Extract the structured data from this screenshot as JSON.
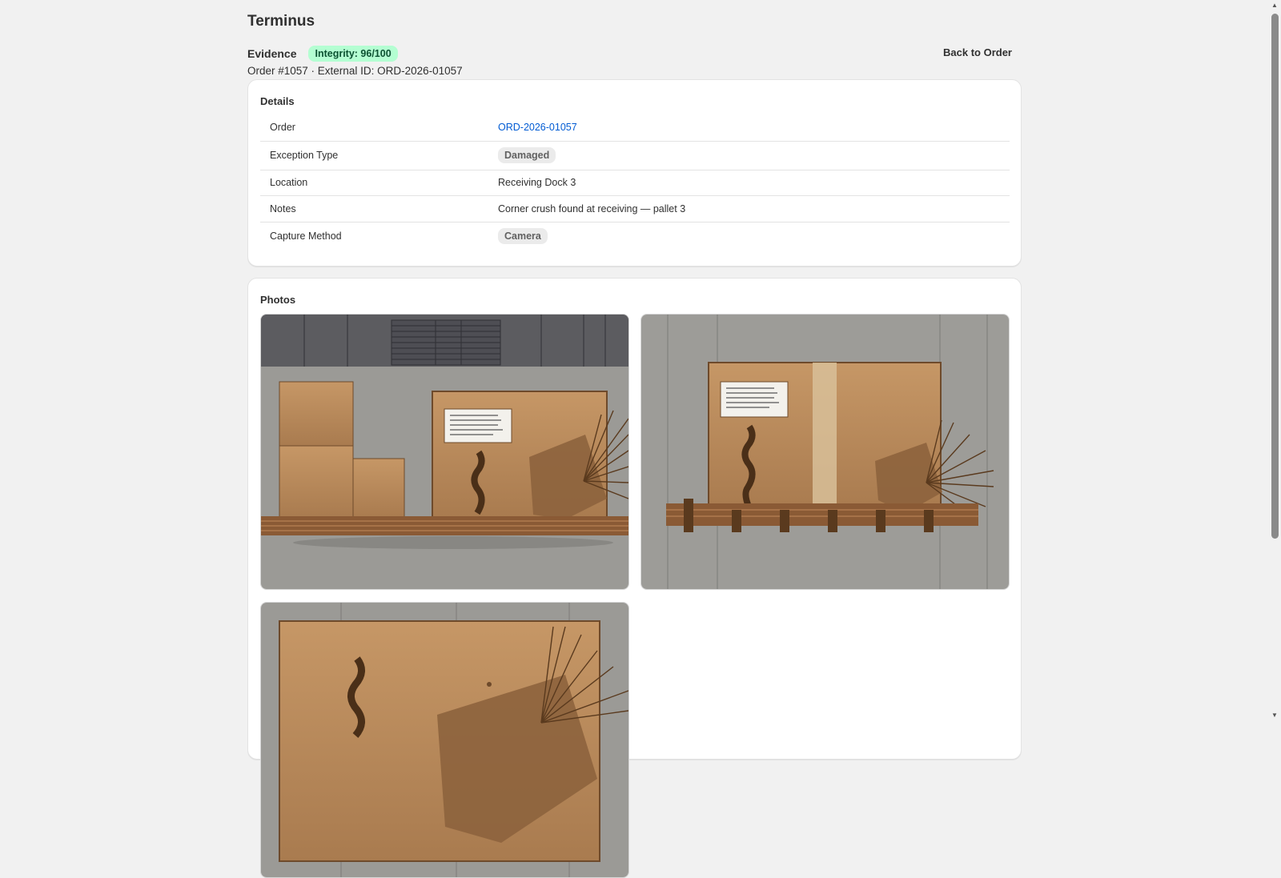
{
  "app": {
    "title": "Terminus"
  },
  "header": {
    "title": "Evidence",
    "integrity_badge": "Integrity: 96/100",
    "back_button": "Back to Order",
    "subtitle": "Order #1057 · External ID: ORD-2026-01057"
  },
  "details": {
    "title": "Details",
    "rows": [
      {
        "label": "Order",
        "value": "ORD-2026-01057"
      },
      {
        "label": "Exception Type",
        "value": "Damaged"
      },
      {
        "label": "Location",
        "value": "Receiving Dock 3"
      },
      {
        "label": "Notes",
        "value": "Corner crush found at receiving — pallet 3"
      },
      {
        "label": "Capture Method",
        "value": "Camera"
      }
    ]
  },
  "photos": {
    "title": "Photos",
    "count_visible": 3
  },
  "colors": {
    "link": "#005bd3",
    "integrity_bg": "#b4fed2",
    "integrity_text": "#0c5132",
    "page_bg": "#f1f1f1"
  }
}
